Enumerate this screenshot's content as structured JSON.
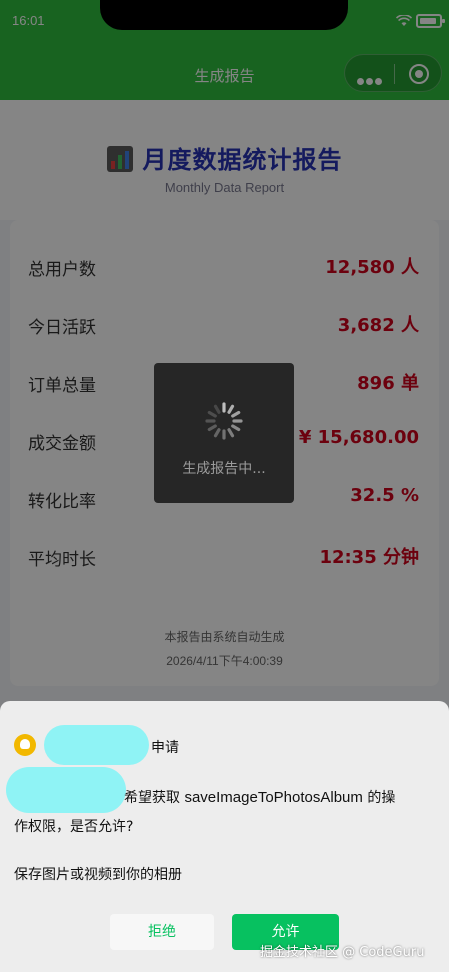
{
  "status_bar": {
    "time": "16:01"
  },
  "navbar": {
    "title": "生成报告",
    "capsule_icons": [
      "more-icon",
      "close-icon"
    ]
  },
  "header": {
    "title": "月度数据统计报告",
    "subtitle": "Monthly Data Report",
    "icon": "chart-icon"
  },
  "stats": [
    {
      "label": "总用户数",
      "value": "12,580 人"
    },
    {
      "label": "今日活跃",
      "value": "3,682 人"
    },
    {
      "label": "订单总量",
      "value": "896 单"
    },
    {
      "label": "成交金额",
      "value": "¥ 15,680.00"
    },
    {
      "label": "转化比率",
      "value": "32.5 %"
    },
    {
      "label": "平均时长",
      "value": "12:35 分钟"
    }
  ],
  "footer": {
    "note": "本报告由系统自动生成",
    "timestamp": "2026/4/11下午4:00:39"
  },
  "loading": {
    "text": "生成报告中..."
  },
  "permission": {
    "apply_label": "申请",
    "request_prefix": "希望获取",
    "api_name": "saveImageToPhotosAlbum",
    "request_suffix": "的操",
    "request_line2": "作权限，是否允许?",
    "description": "保存图片或视频到你的相册",
    "deny_label": "拒绝",
    "allow_label": "允许"
  },
  "watermark": "掘金技术社区 @ CodeGuru",
  "colors": {
    "brand_green": "#2fbf3f",
    "value_red": "#d0021b",
    "title_blue": "#2733b5",
    "allow_green": "#07c160"
  }
}
